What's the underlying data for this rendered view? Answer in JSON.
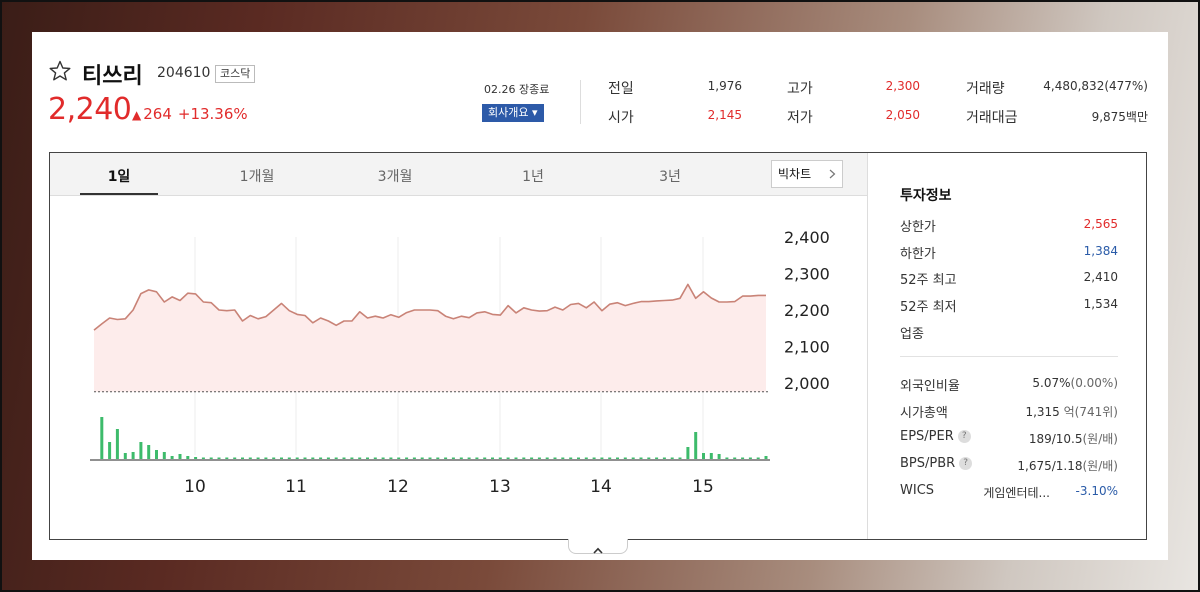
{
  "stock": {
    "name": "티쓰리",
    "code": "204610",
    "market": "코스닥",
    "price": "2,240",
    "change_arrow": "▲",
    "change": "264",
    "change_pct": "+13.36%",
    "close_label": "02.26 장종료",
    "company_button": "회사개요 ▾"
  },
  "stats": {
    "prev_close_label": "전일",
    "prev_close": "1,976",
    "open_label": "시가",
    "open": "2,145",
    "high_label": "고가",
    "high": "2,300",
    "low_label": "저가",
    "low": "2,050",
    "volume_label": "거래량",
    "volume": "4,480,832(477%)",
    "amount_label": "거래대금",
    "amount": "9,875백만"
  },
  "colors": {
    "up": "#e12b2b",
    "down": "#2a5ba8",
    "line": "#c98377",
    "area": "#fdeceb",
    "volume": "#3dbb6b",
    "accent_button": "#2d5aa8"
  },
  "tabs": [
    {
      "label": "1일",
      "active": true
    },
    {
      "label": "1개월",
      "active": false
    },
    {
      "label": "3개월",
      "active": false
    },
    {
      "label": "1년",
      "active": false
    },
    {
      "label": "3년",
      "active": false
    }
  ],
  "big_chart_button": "빅차트",
  "chart_data": {
    "type": "area",
    "x_tick_labels": [
      "10",
      "11",
      "12",
      "13",
      "14",
      "15"
    ],
    "y_tick_labels": [
      "2,400",
      "2,300",
      "2,200",
      "2,100",
      "2,000"
    ],
    "ylim": [
      2000,
      2400
    ],
    "grid": "vertical",
    "reference_line": 1976,
    "series": [
      {
        "values": [
          2145,
          2162,
          2178,
          2174,
          2176,
          2200,
          2245,
          2255,
          2250,
          2222,
          2236,
          2226,
          2246,
          2244,
          2222,
          2220,
          2200,
          2198,
          2200,
          2170,
          2185,
          2176,
          2182,
          2200,
          2218,
          2198,
          2188,
          2185,
          2165,
          2178,
          2170,
          2158,
          2170,
          2170,
          2195,
          2178,
          2183,
          2178,
          2187,
          2180,
          2193,
          2200,
          2200,
          2200,
          2198,
          2183,
          2176,
          2183,
          2179,
          2192,
          2195,
          2188,
          2186,
          2212,
          2192,
          2206,
          2200,
          2197,
          2198,
          2208,
          2200,
          2215,
          2218,
          2206,
          2222,
          2198,
          2216,
          2220,
          2212,
          2218,
          2223,
          2223,
          2225,
          2226,
          2227,
          2232,
          2270,
          2232,
          2250,
          2233,
          2222,
          2222,
          2223,
          2238,
          2238,
          2240,
          2240
        ]
      }
    ],
    "volume_series": [
      {
        "values": [
          0,
          42,
          17,
          30,
          6,
          7,
          17,
          14,
          9,
          7,
          3,
          5,
          3,
          2,
          1,
          1,
          1,
          1,
          1,
          1,
          1,
          1,
          1,
          1,
          1,
          1,
          1,
          1,
          1,
          1,
          1,
          1,
          1,
          1,
          1,
          1,
          1,
          1,
          1,
          1,
          1,
          1,
          1,
          1,
          1,
          1,
          1,
          1,
          1,
          1,
          1,
          1,
          1,
          1,
          1,
          1,
          1,
          1,
          1,
          1,
          1,
          1,
          1,
          1,
          1,
          1,
          1,
          1,
          1,
          1,
          1,
          1,
          1,
          1,
          1,
          1,
          12,
          27,
          6,
          6,
          5,
          1,
          1,
          1,
          1,
          1,
          3
        ]
      }
    ]
  },
  "investment": {
    "title": "투자정보",
    "upper_limit_label": "상한가",
    "upper_limit": "2,565",
    "lower_limit_label": "하한가",
    "lower_limit": "1,384",
    "high52_label": "52주 최고",
    "high52": "2,410",
    "low52_label": "52주 최저",
    "low52": "1,534",
    "industry_label": "업종",
    "foreign_label": "외국인비율",
    "foreign": "5.07%",
    "foreign_sub": "(0.00%)",
    "mcap_label": "시가총액",
    "mcap": "1,315",
    "mcap_unit": "억(741위)",
    "eps_per_label": "EPS/PER",
    "eps_per": "189/10.5",
    "eps_per_unit": "(원/배)",
    "bps_pbr_label": "BPS/PBR",
    "bps_pbr": "1,675/1.18",
    "bps_pbr_unit": "(원/배)",
    "wics_label": "WICS",
    "wics_name": "게임엔터테...",
    "wics_change": "-3.10%",
    "help_mark": "?"
  },
  "icons": {
    "favorite": "star-icon",
    "collapse": "chevron-up-icon",
    "bigchart": "chevron-right-icon"
  }
}
